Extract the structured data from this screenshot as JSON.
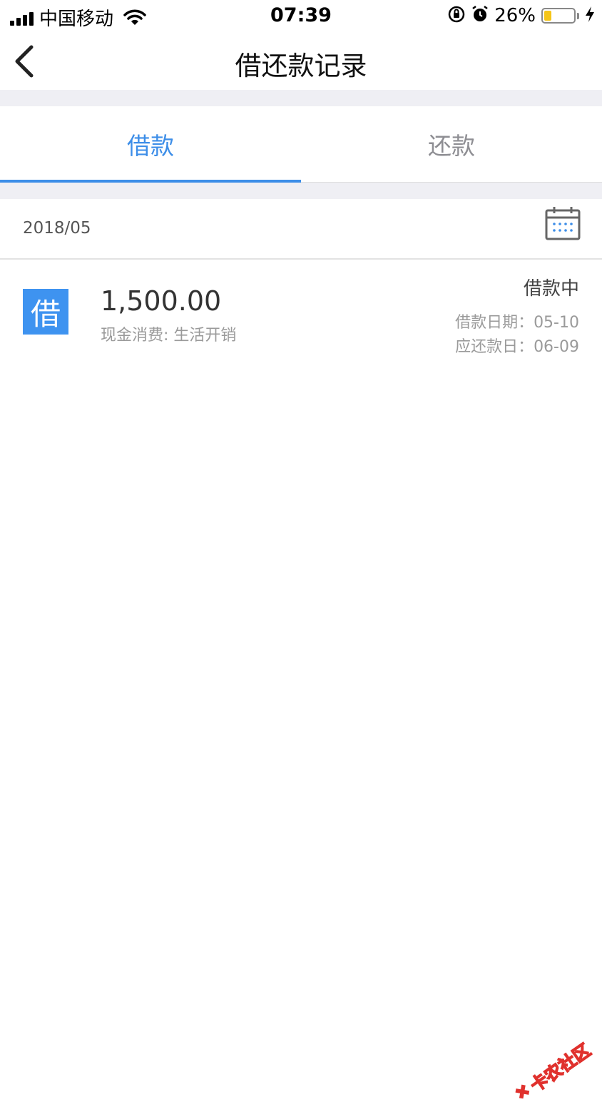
{
  "status_bar": {
    "carrier": "中国移动",
    "time": "07:39",
    "battery_percent": "26%",
    "battery_level": 0.26
  },
  "nav": {
    "title": "借还款记录",
    "back_icon": "chevron-left-icon"
  },
  "tabs": [
    {
      "label": "借款",
      "active": true
    },
    {
      "label": "还款",
      "active": false
    }
  ],
  "month": "2018/05",
  "records": [
    {
      "badge": "借",
      "amount": "1,500.00",
      "purpose": "现金消费: 生活开销",
      "status": "借款中",
      "loan_date": "借款日期：05-10",
      "due_date": "应还款日：06-09"
    }
  ],
  "watermark": {
    "text": "卡农社区"
  },
  "colors": {
    "accent": "#3d8ee8",
    "badge": "#3e93f0",
    "band": "#efeff4",
    "battery": "#f5c518"
  }
}
